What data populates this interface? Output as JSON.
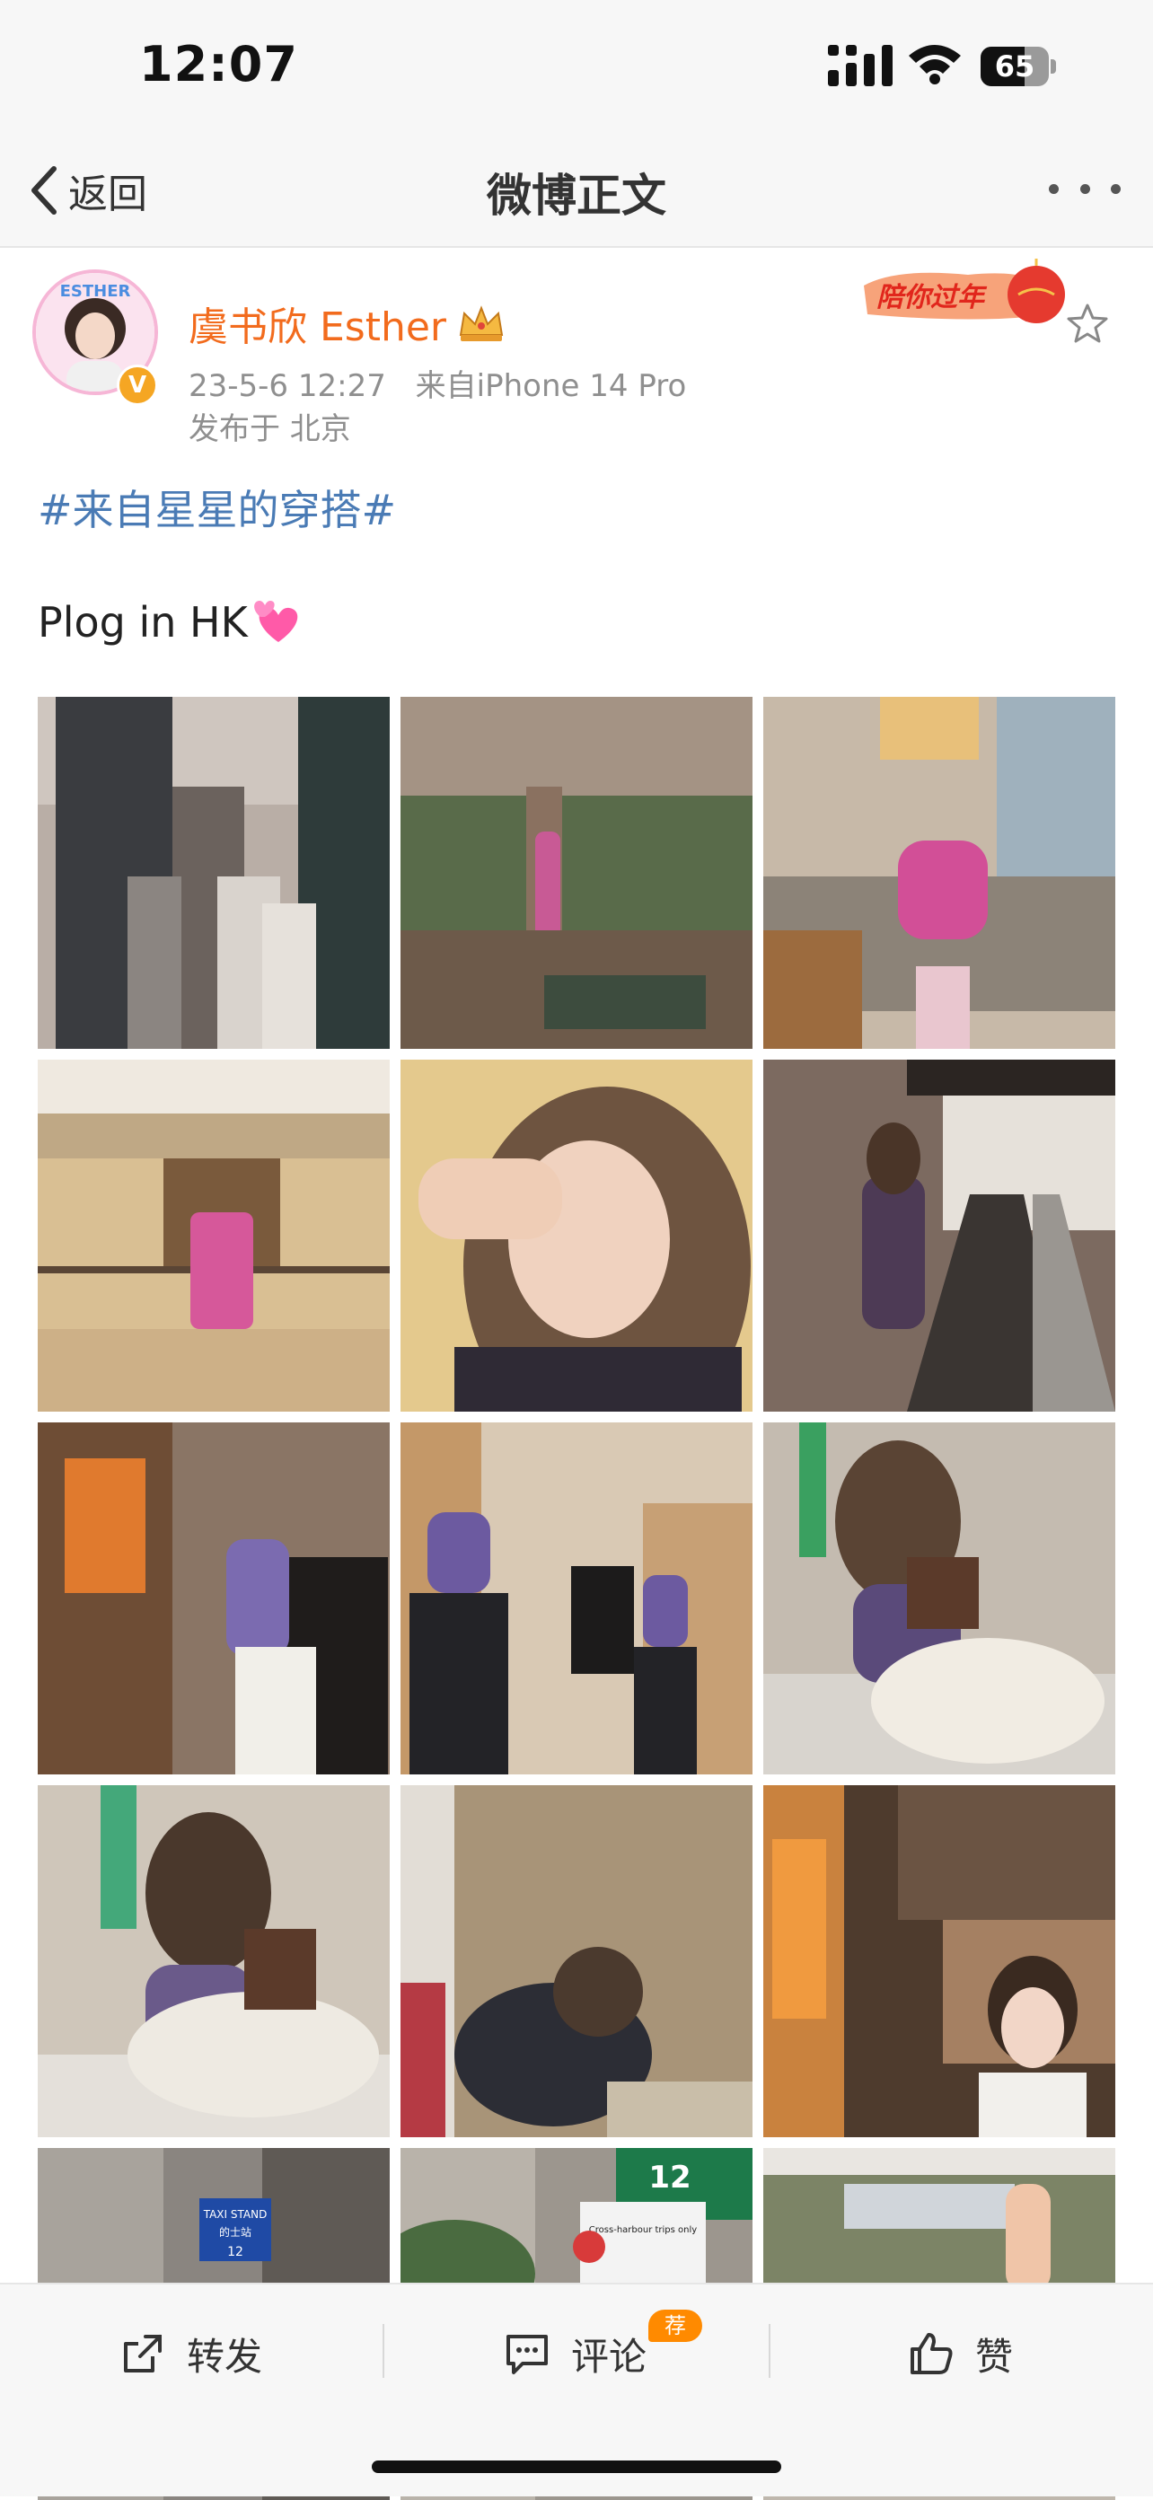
{
  "status_bar": {
    "time": "12:07",
    "battery_level": "65",
    "battery_fraction": 0.65
  },
  "nav": {
    "back_label": "返回",
    "title": "微博正文"
  },
  "post": {
    "user_name": "虞书欣 Esther",
    "avatar_text": "ESTHER",
    "verified_mark": "V",
    "time": "23-5-6 12:27",
    "source": "来自iPhone 14 Pro",
    "location": "发布于 北京",
    "badge_text": "陪你过年",
    "hashtag": "#来自星星的穿搭#",
    "text": "Plog in HK"
  },
  "photos": [
    {
      "name": "hk-skyline"
    },
    {
      "name": "hotel-corner-window"
    },
    {
      "name": "sofa-pink-hoodie"
    },
    {
      "name": "atrium-pink-dress"
    },
    {
      "name": "selfie-salute"
    },
    {
      "name": "escalator-down"
    },
    {
      "name": "escalator-pose"
    },
    {
      "name": "mirror-pair"
    },
    {
      "name": "crouch-phone"
    },
    {
      "name": "crouch-mirror"
    },
    {
      "name": "puffer-jacket"
    },
    {
      "name": "lobby-orange"
    },
    {
      "name": "taxi-stand"
    },
    {
      "name": "street-signs"
    },
    {
      "name": "harbour-view"
    }
  ],
  "photo_text": {
    "taxi_sign": "TAXI STAND",
    "taxi_sign_cn": "的士站",
    "route_sign": "12",
    "cross_harbour": "Cross-harbour trips only"
  },
  "actions": {
    "repost": "转发",
    "comment": "评论",
    "recommend_badge": "荐",
    "like": "赞"
  },
  "colors": {
    "accent_orange": "#f26b1d",
    "hashtag_blue": "#4a7bb5",
    "verified_orange": "#f5a623"
  }
}
